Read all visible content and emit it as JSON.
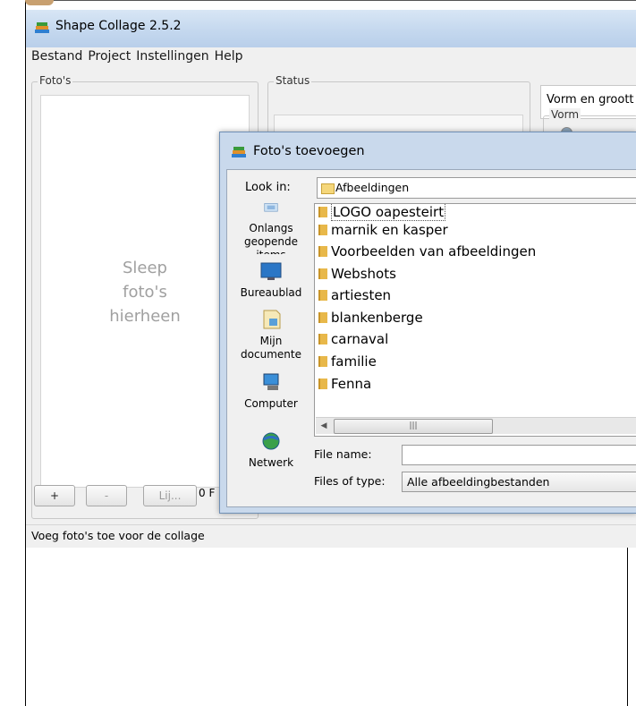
{
  "main_window": {
    "title": "Shape Collage 2.5.2",
    "menu": [
      "Bestand",
      "Project",
      "Instellingen",
      "Help"
    ],
    "photos_group_label": "Foto's",
    "drop_hint": [
      "Sleep",
      "foto's",
      "hierheen"
    ],
    "add_button": "+",
    "remove_button": "-",
    "list_button": "Lij...",
    "photo_count": "0 F",
    "status_group_label": "Status",
    "shape_panel_title": "Vorm en groott",
    "vorm_group_label": "Vorm",
    "status_bar_text": "Voeg foto's toe voor de collage"
  },
  "dialog": {
    "title": "Foto's toevoegen",
    "look_in_label": "Look in:",
    "look_in_value": "Afbeeldingen",
    "places": [
      {
        "label": "Onlangs geopende items",
        "icon": "recent-items-icon"
      },
      {
        "label": "Bureaublad",
        "icon": "desktop-icon"
      },
      {
        "label": "Mijn documente",
        "icon": "documents-icon"
      },
      {
        "label": "Computer",
        "icon": "computer-icon"
      },
      {
        "label": "Netwerk",
        "icon": "network-icon"
      }
    ],
    "files": [
      "LOGO oapesteirt",
      "marnik en kasper",
      "Voorbeelden van afbeeldingen",
      "Webshots",
      "artiesten",
      "blankenberge",
      "carnaval",
      "familie",
      "Fenna"
    ],
    "selected_file": "LOGO oapesteirt",
    "file_name_label": "File name:",
    "file_name_value": "",
    "files_of_type_label": "Files of type:",
    "files_of_type_value": "Alle afbeeldingbestanden"
  },
  "colors": {
    "titlebar": "#c3d7ee",
    "window_bg": "#f0f0f0",
    "dialog_frame": "#c9d9ec",
    "folder": "#e8b84a"
  }
}
